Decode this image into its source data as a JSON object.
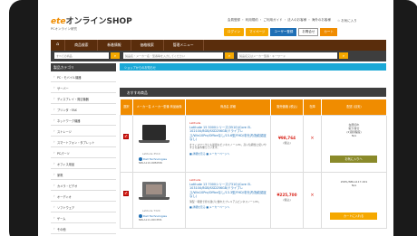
{
  "header": {
    "logo_mark": "ete",
    "logo_text": "オンラインSHOP",
    "logo_sub": "PCオンライン研究",
    "links": "会員登録 ・ 利用規約 ・ ご利用ガイド ・ 法人のお客様 ・ 海外のお客様",
    "guide": "ご利用ガイド",
    "fav": "☆ お気に入り",
    "login_btn": "ログイン",
    "mypage_btn": "マイページ",
    "account_btn": "ユーザー登録",
    "register_btn": "お問合せ",
    "cart_btn": "カート"
  },
  "nav": {
    "items": [
      "商品検索",
      "新着情報",
      "価格検索",
      "管理メニュー"
    ]
  },
  "search": {
    "placeholder1": "すべての商品",
    "placeholder2": "製品名・メーカー名・型番等を入力してください",
    "placeholder3": "製品名又はメーカー型番・キーワード"
  },
  "sidebar": {
    "title": "製品カテゴリ",
    "items": [
      "PC・モバイル機器",
      "サーバー",
      "ディスプレイ・周辺機器",
      "プリンタ・FAX",
      "ネットワーク機器",
      "ストレージ",
      "スマートフォン・タブレット",
      "PCパーツ",
      "オフィス用品",
      "家電",
      "カメラ・ビデオ",
      "オーディオ",
      "ソフトウェア",
      "ゲーム",
      "その他"
    ]
  },
  "main": {
    "info_bar": "ショップからのお知らせ",
    "section_title": "おすすめ商品",
    "columns": [
      "選択",
      "メーカー名\nメーカー型番\n商品画像",
      "商品名\n詳細",
      "販売価格\n(税込)",
      "在庫",
      "配送\n(目安)"
    ],
    "products": [
      {
        "brand": "Latitude",
        "name": "Latitude 15 3000シリーズ(3510)(Core i5-10210U/8GB/SSD256GB/ドライブレス/Win10Pro/Officeなし/15.6型/FHD/非光沢/指紋認証なし)",
        "desc": "オフィスワークにも最適なビジネスノートPC。高い信頼性と使いやすさを兼ね備えています。",
        "links": "■ 詳細を見る  ■ メーカーページへ",
        "model": "Latitude 3510",
        "maker": "Dell Technologies",
        "mcode": "NBLA110-00B2MN",
        "price": "¥98,764",
        "price_tax": "(税込)",
        "stock": "×",
        "ship": "在庫切れ\n取り寄せ\n(2週間程度)\nN/A",
        "cart": "お気に入りへ"
      },
      {
        "brand": "Latitude",
        "name": "Latitude 13 7000シリーズ(7310)(Core i5-10310U/8GB/SSD256GB/ドライブレス/Win10Pro/Officeなし/13.3型/FHD/非光沢/指紋認証なし)",
        "desc": "薄型・軽量で持ち運びに優れたプレミアムビジネスノートPC。",
        "links": "■ 詳細を見る  ■ メーカーページへ",
        "model": "Latitude 7320",
        "maker": "Dell Technologies",
        "mcode": "NBLA111-00C3MS",
        "price": "¥225,700",
        "price_tax": "(税込)",
        "stock": "×",
        "ship": "ZOEL/NBLA117-001\nN/A",
        "cart": "カートに入れる"
      }
    ]
  },
  "colors": {
    "accent_orange": "#f08c00",
    "nav_brown": "#5a2d0c",
    "dark_bar": "#3e3e3e",
    "info_blue": "#1ba8d6",
    "price_red": "#d9261c"
  }
}
